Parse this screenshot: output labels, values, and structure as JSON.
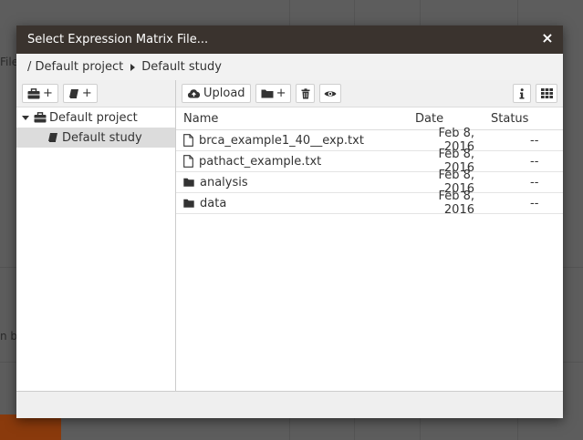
{
  "background": {
    "fragment_top": "File",
    "fragment_mid": "n bu"
  },
  "dialog": {
    "title": "Select Expression Matrix File...",
    "close_icon": "×"
  },
  "breadcrumb": {
    "project": "/ Default project",
    "study": "Default study"
  },
  "left_toolbar": {
    "add_project": "+",
    "add_study": "+"
  },
  "right_toolbar": {
    "upload_label": "Upload",
    "new_folder": "+"
  },
  "tree": {
    "project_label": "Default project",
    "study_label": "Default study"
  },
  "files": {
    "headers": {
      "name": "Name",
      "date": "Date",
      "status": "Status"
    },
    "rows": [
      {
        "type": "file",
        "name": "brca_example1_40__exp.txt",
        "date": "Feb 8, 2016",
        "status": "--"
      },
      {
        "type": "file",
        "name": "pathact_example.txt",
        "date": "Feb 8, 2016",
        "status": "--"
      },
      {
        "type": "folder",
        "name": "analysis",
        "date": "Feb 8, 2016",
        "status": "--"
      },
      {
        "type": "folder",
        "name": "data",
        "date": "Feb 8, 2016",
        "status": "--"
      }
    ]
  }
}
